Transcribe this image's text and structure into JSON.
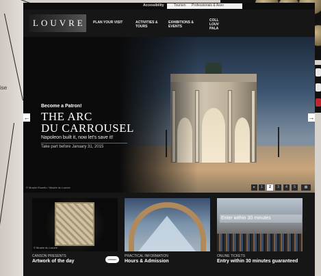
{
  "background": {
    "left_text": "ise"
  },
  "topbar": {
    "accessibility": "Accessibility",
    "tourism": "Tourism",
    "professionals": "Professionals & Asso"
  },
  "nav": {
    "logo": "LOUVRE",
    "items": [
      {
        "line1": "PLAN YOUR VISIT",
        "line2": ""
      },
      {
        "line1": "ACTIVITIES &",
        "line2": "TOURS"
      },
      {
        "line1": "EXHIBITIONS &",
        "line2": "EVENTS"
      },
      {
        "line1": "COLL",
        "line2": "LOUV"
      },
      {
        "line1": "",
        "line2": "PALA"
      }
    ]
  },
  "hero": {
    "kicker": "Become a Patron!",
    "title_line1": "THE ARC",
    "title_line2": "DU CARROUSEL",
    "subtitle": "Napoleon built it, now let's save it!",
    "date_text": "Take part before January 31, 2015",
    "credit": "© Musée Rosello / Musée du Louvre",
    "prev_arrow": "←",
    "next_arrow": "→",
    "pager": [
      "1",
      "2",
      "3",
      "4",
      "5"
    ],
    "pager_active": "2",
    "pager_prev": "▸"
  },
  "tiles": [
    {
      "kicker": "CANSON PRESENTS",
      "title": "Artwork of the day",
      "note": "© Musée du Louvre",
      "badge": "canson"
    },
    {
      "kicker": "PRACTICAL INFORMATION",
      "title": "Hours & Admission"
    },
    {
      "kicker": "ONLINE TICKETS",
      "title": "Entry within 30 minutes guaranteed",
      "overlay": "Enter within 30 minutes"
    }
  ],
  "colors": {
    "site_bg": "#161616",
    "hero_text": "#ffffff",
    "accent_dark": "#0d0d0d"
  }
}
